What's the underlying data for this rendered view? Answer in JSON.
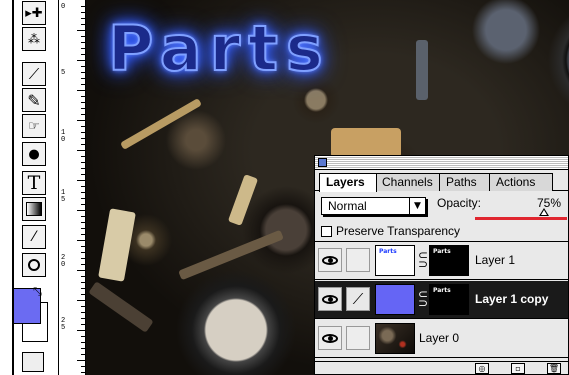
{
  "toolbox": {
    "tools": [
      {
        "name": "move-tool",
        "icon": "move-icon",
        "glyph": "▸✚"
      },
      {
        "name": "magic-wand-tool",
        "icon": "magic-wand-icon",
        "glyph": "⁂"
      },
      {
        "name": "paintbrush-tool",
        "icon": "paintbrush-icon",
        "glyph": "🖌"
      },
      {
        "name": "pencil-tool",
        "icon": "pencil-icon",
        "glyph": "✎"
      },
      {
        "name": "smudge-tool",
        "icon": "smudge-icon",
        "glyph": "☝"
      },
      {
        "name": "burn-tool",
        "icon": "burn-icon",
        "glyph": "●"
      },
      {
        "name": "type-tool",
        "icon": "type-icon",
        "glyph": "T"
      },
      {
        "name": "gradient-tool",
        "icon": "gradient-icon",
        "glyph": "▣"
      },
      {
        "name": "eyedropper-tool",
        "icon": "eyedropper-icon",
        "glyph": "⤵"
      },
      {
        "name": "zoom-tool",
        "icon": "zoom-icon",
        "glyph": "🔍"
      }
    ],
    "foreground_color": "#6b6bf2",
    "background_color": "#ffffff",
    "swap_glyph": "⤡"
  },
  "ruler": {
    "labels": [
      "0",
      "5",
      "1\n0",
      "1\n5",
      "2\n0",
      "2\n5",
      "3\n0"
    ]
  },
  "canvas": {
    "title_text": "Parts",
    "glow_color": "#3f6bff"
  },
  "layers_panel": {
    "tabs": [
      "Layers",
      "Channels",
      "Paths",
      "Actions"
    ],
    "active_tab": "Layers",
    "blend_mode": "Normal",
    "opacity_label": "Opacity:",
    "opacity_value": "75%",
    "opacity_fraction": 0.75,
    "preserve_transparency_label": "Preserve Transparency",
    "preserve_transparency_checked": false,
    "thumb_label": "Parts",
    "layers": [
      {
        "name": "Layer 1",
        "visible": true,
        "selected": false,
        "has_mask": true,
        "thumb": "text"
      },
      {
        "name": "Layer 1 copy",
        "visible": true,
        "selected": true,
        "has_mask": true,
        "thumb": "solid"
      },
      {
        "name": "Layer 0",
        "visible": true,
        "selected": false,
        "has_mask": false,
        "thumb": "photo"
      }
    ]
  }
}
